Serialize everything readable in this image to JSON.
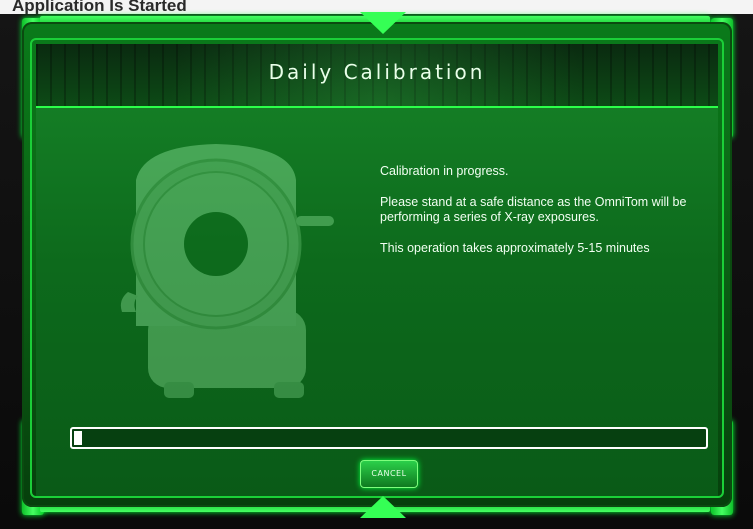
{
  "window": {
    "top_strip_text": "Application Is Started",
    "title": "Daily Calibration"
  },
  "message": {
    "line1": "Calibration in progress.",
    "line2": "Please stand at a safe distance as the OmniTom will be performing a series of X-ray exposures.",
    "line3": "This operation takes approximately 5-15 minutes"
  },
  "progress": {
    "fraction": 0.012
  },
  "buttons": {
    "cancel": "CANCEL"
  },
  "colors": {
    "accent": "#2cff4a",
    "panel": "#0d6a1c",
    "text": "#f2fff2"
  },
  "icons": {
    "machine": "ct-scanner-illustration"
  }
}
